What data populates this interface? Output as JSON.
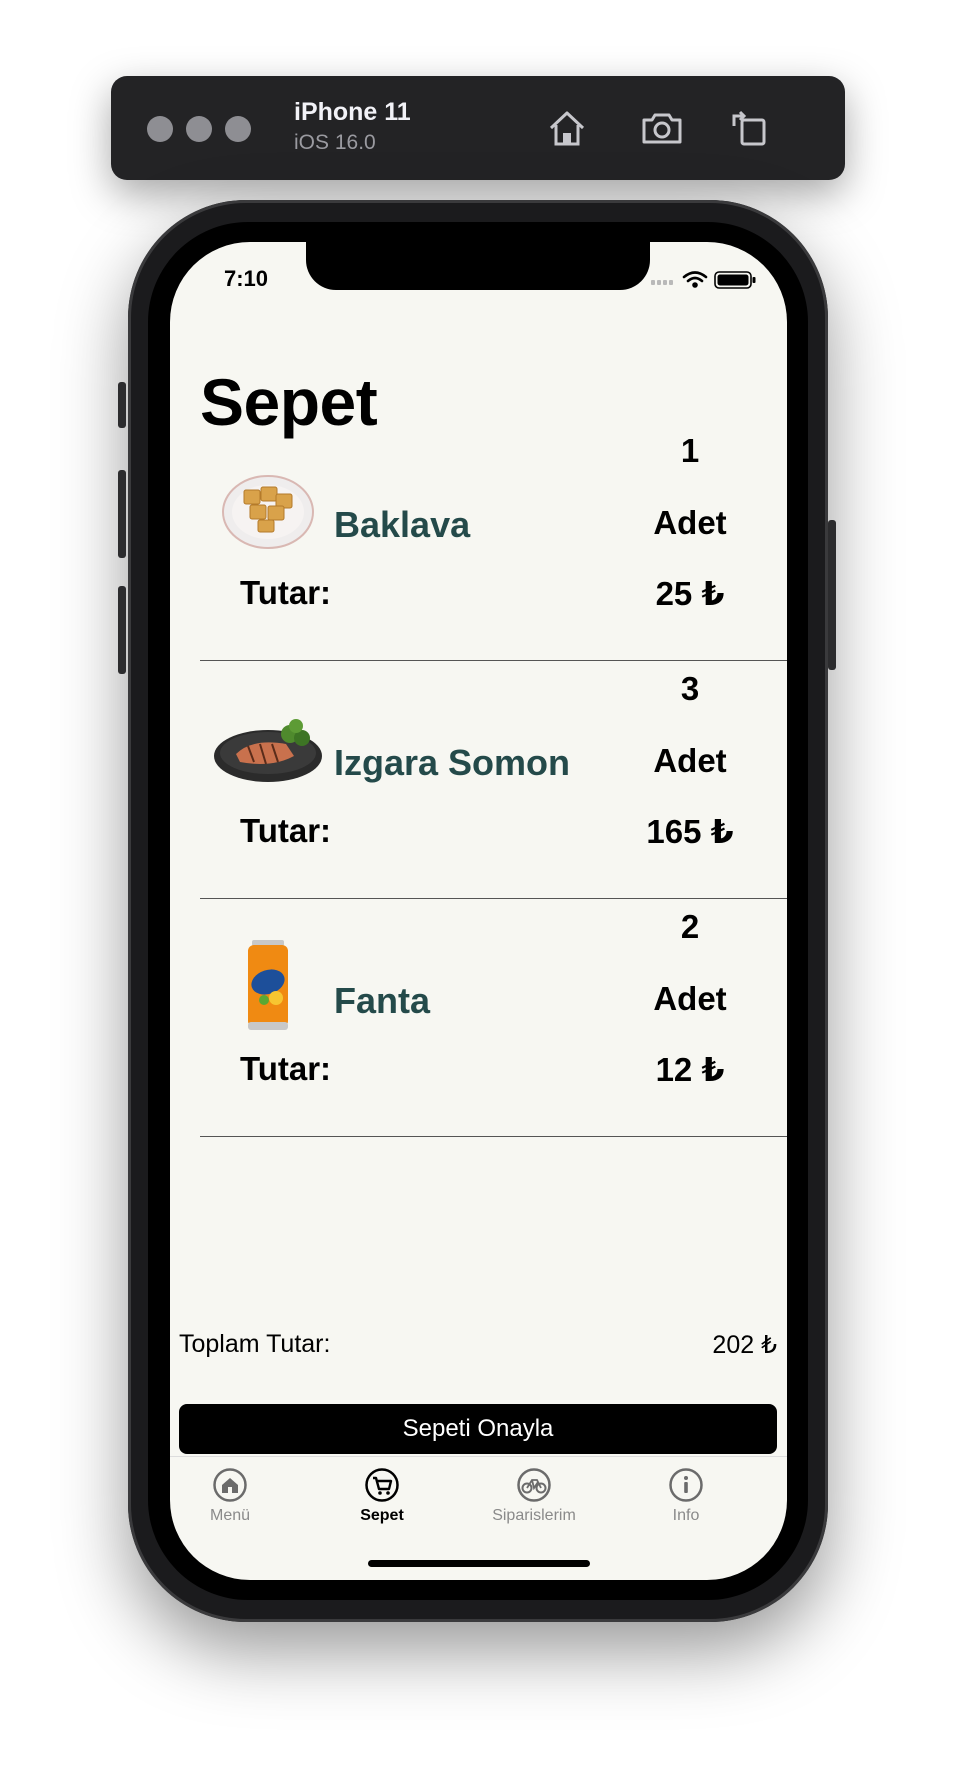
{
  "simulator": {
    "device": "iPhone 11",
    "os": "iOS 16.0"
  },
  "status_bar": {
    "time": "7:10"
  },
  "page": {
    "title": "Sepet"
  },
  "cart": {
    "items": [
      {
        "name": "Baklava",
        "quantity": "1",
        "unit": "Adet",
        "amount_label": "Tutar:",
        "amount": "25 ₺",
        "image": "baklava-image"
      },
      {
        "name": "Izgara Somon",
        "quantity": "3",
        "unit": "Adet",
        "amount_label": "Tutar:",
        "amount": "165 ₺",
        "image": "grilled-salmon-image"
      },
      {
        "name": "Fanta",
        "quantity": "2",
        "unit": "Adet",
        "amount_label": "Tutar:",
        "amount": "12 ₺",
        "image": "fanta-can-image"
      }
    ],
    "total_label": "Toplam Tutar:",
    "total_value": "202 ₺",
    "confirm_label": "Sepeti Onayla"
  },
  "tabbar": {
    "tabs": [
      {
        "label": "Menü",
        "icon": "home-icon",
        "active": false
      },
      {
        "label": "Sepet",
        "icon": "cart-icon",
        "active": true
      },
      {
        "label": "Siparislerim",
        "icon": "bicycle-icon",
        "active": false
      },
      {
        "label": "Info",
        "icon": "info-icon",
        "active": false
      }
    ]
  },
  "colors": {
    "background": "#f7f7f2",
    "item_name": "#244a4a",
    "button": "#000000"
  }
}
